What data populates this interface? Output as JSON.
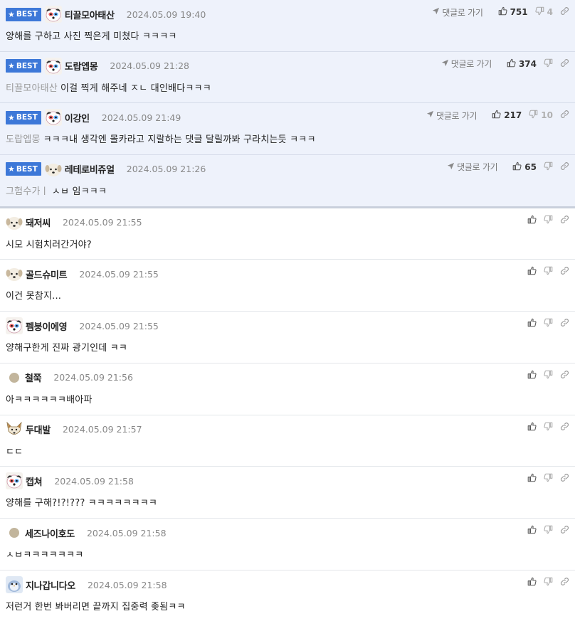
{
  "labels": {
    "best": "BEST",
    "reply": "댓글로 가기"
  },
  "comments": [
    {
      "best": true,
      "avatar": "dog-mask",
      "nick": "티끌모아태산",
      "date": "2024.05.09 19:40",
      "parent": "",
      "text": "양해를 구하고 사진 찍은게 미쳤다 ㅋㅋㅋㅋ",
      "likes": "751",
      "dislikes": "4"
    },
    {
      "best": true,
      "avatar": "dog-mask",
      "nick": "도랍엡몽",
      "date": "2024.05.09 21:28",
      "parent": "티끌모아태산",
      "text": "이걸 찍게 해주네 ㅈㄴ 대인배다ㅋㅋㅋ",
      "likes": "374",
      "dislikes": ""
    },
    {
      "best": true,
      "avatar": "dog-mask",
      "nick": "이강인",
      "date": "2024.05.09 21:49",
      "parent": "도랍엡몽",
      "text": "ㅋㅋㅋ내 생각엔 몰카라고 지랄하는 댓글 달릴까봐 구라치는듯 ㅋㅋㅋ",
      "likes": "217",
      "dislikes": "10"
    },
    {
      "best": true,
      "avatar": "dog-face",
      "nick": "레테로비쥬얼",
      "date": "2024.05.09 21:26",
      "parent": "그험수가ㅣ",
      "text": "ㅅㅂ 임ㅋㅋㅋ",
      "likes": "65",
      "dislikes": ""
    },
    {
      "best": false,
      "avatar": "dog-face",
      "nick": "돼저씨",
      "date": "2024.05.09 21:55",
      "parent": "",
      "text": "시모 시험치러간거야?"
    },
    {
      "best": false,
      "avatar": "dog-face",
      "nick": "골드슈미트",
      "date": "2024.05.09 21:55",
      "parent": "",
      "text": "이건 못참지..."
    },
    {
      "best": false,
      "avatar": "dog-mask",
      "nick": "펨붕이에영",
      "date": "2024.05.09 21:55",
      "parent": "",
      "text": "양해구한게 진짜 광기인데 ㅋㅋ"
    },
    {
      "best": false,
      "avatar": "dot",
      "nick": "철쭉",
      "date": "2024.05.09 21:56",
      "parent": "",
      "text": "아ㅋㅋㅋㅋㅋㅋ배아파"
    },
    {
      "best": false,
      "avatar": "fox",
      "nick": "두대발",
      "date": "2024.05.09 21:57",
      "parent": "",
      "text": "ㄷㄷ"
    },
    {
      "best": false,
      "avatar": "dog-mask",
      "nick": "캡쳐",
      "date": "2024.05.09 21:58",
      "parent": "",
      "text": "양해를 구해?!?!??? ㅋㅋㅋㅋㅋㅋㅋㅋ"
    },
    {
      "best": false,
      "avatar": "dot",
      "nick": "세즈나이호도",
      "date": "2024.05.09 21:58",
      "parent": "",
      "text": "ㅅㅂㅋㅋㅋㅋㅋㅋㅋ"
    },
    {
      "best": false,
      "avatar": "bird",
      "nick": "지나갑니다오",
      "date": "2024.05.09 21:58",
      "parent": "",
      "text": "저런거 한번 봐버리면 끝까지 집중력 좆됨ㅋㅋ"
    }
  ],
  "colors": {
    "best_bg": "#eef2fb",
    "badge": "#3d78d8",
    "date": "#888888",
    "parent": "#999999"
  }
}
